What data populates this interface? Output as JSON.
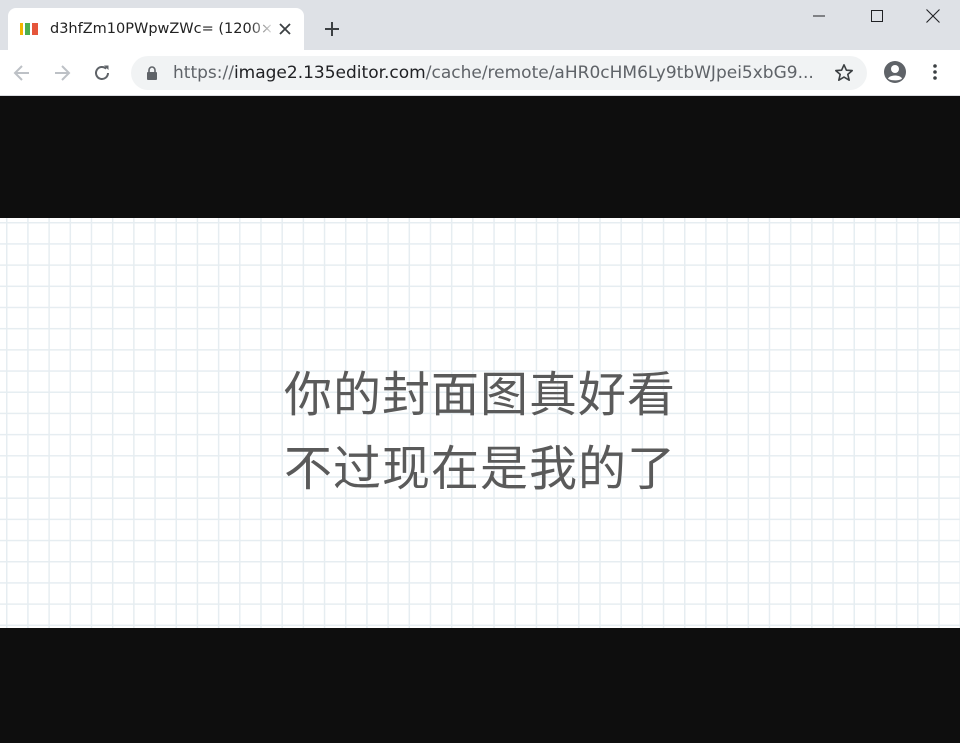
{
  "tab": {
    "title": "d3hfZm10PWpwZWc= (1200×",
    "favicon": "135editor-icon"
  },
  "address": {
    "scheme": "https://",
    "host": "image2.135editor.com",
    "path": "/cache/remote/aHR0cHM6Ly9tbWJpei5xbG9..."
  },
  "icons": {
    "back": "arrow-left-icon",
    "forward": "arrow-right-icon",
    "reload": "reload-icon",
    "lock": "lock-icon",
    "bookmark": "star-icon",
    "profile": "account-circle-icon",
    "menu": "kebab-menu-icon"
  },
  "cover": {
    "line1": "你的封面图真好看",
    "line2": "不过现在是我的了"
  },
  "colors": {
    "tab_strip": "#dee1e6",
    "omnibox": "#f1f3f4",
    "viewport_bg": "#0e0e0e",
    "grid_line": "#e6edf1",
    "cover_text": "#5a5a5a"
  }
}
